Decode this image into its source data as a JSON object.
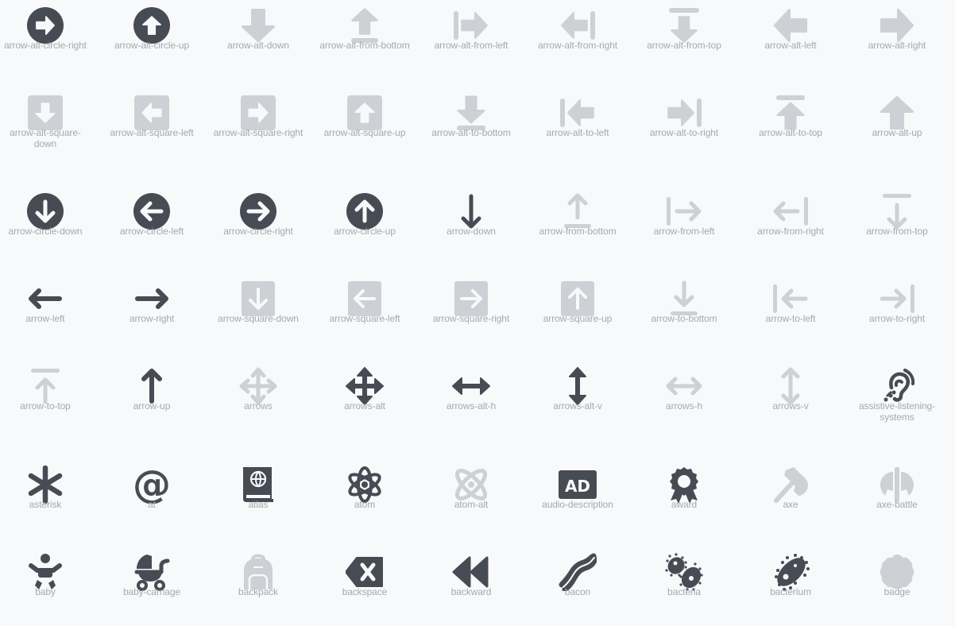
{
  "colors": {
    "background": "#f7f9fa",
    "icon_dark": "#474b53",
    "icon_light": "#cdd0d5",
    "label": "#a5a9b0"
  },
  "rows": [
    [
      {
        "name": "arrow-alt-circle-right",
        "tone": "dark"
      },
      {
        "name": "arrow-alt-circle-up",
        "tone": "dark"
      },
      {
        "name": "arrow-alt-down",
        "tone": "light"
      },
      {
        "name": "arrow-alt-from-bottom",
        "tone": "light"
      },
      {
        "name": "arrow-alt-from-left",
        "tone": "light"
      },
      {
        "name": "arrow-alt-from-right",
        "tone": "light"
      },
      {
        "name": "arrow-alt-from-top",
        "tone": "light"
      },
      {
        "name": "arrow-alt-left",
        "tone": "light"
      },
      {
        "name": "arrow-alt-right",
        "tone": "light"
      }
    ],
    [
      {
        "name": "arrow-alt-square-down",
        "tone": "light",
        "label_lines": [
          "arrow-alt-square-",
          "down"
        ]
      },
      {
        "name": "arrow-alt-square-left",
        "tone": "light"
      },
      {
        "name": "arrow-alt-square-right",
        "tone": "light"
      },
      {
        "name": "arrow-alt-square-up",
        "tone": "light"
      },
      {
        "name": "arrow-alt-to-bottom",
        "tone": "light"
      },
      {
        "name": "arrow-alt-to-left",
        "tone": "light"
      },
      {
        "name": "arrow-alt-to-right",
        "tone": "light"
      },
      {
        "name": "arrow-alt-to-top",
        "tone": "light"
      },
      {
        "name": "arrow-alt-up",
        "tone": "light"
      }
    ],
    [
      {
        "name": "arrow-circle-down",
        "tone": "dark"
      },
      {
        "name": "arrow-circle-left",
        "tone": "dark"
      },
      {
        "name": "arrow-circle-right",
        "tone": "dark"
      },
      {
        "name": "arrow-circle-up",
        "tone": "dark"
      },
      {
        "name": "arrow-down",
        "tone": "dark"
      },
      {
        "name": "arrow-from-bottom",
        "tone": "light"
      },
      {
        "name": "arrow-from-left",
        "tone": "light"
      },
      {
        "name": "arrow-from-right",
        "tone": "light"
      },
      {
        "name": "arrow-from-top",
        "tone": "light"
      }
    ],
    [
      {
        "name": "arrow-left",
        "tone": "dark"
      },
      {
        "name": "arrow-right",
        "tone": "dark"
      },
      {
        "name": "arrow-square-down",
        "tone": "light"
      },
      {
        "name": "arrow-square-left",
        "tone": "light"
      },
      {
        "name": "arrow-square-right",
        "tone": "light"
      },
      {
        "name": "arrow-square-up",
        "tone": "light"
      },
      {
        "name": "arrow-to-bottom",
        "tone": "light"
      },
      {
        "name": "arrow-to-left",
        "tone": "light"
      },
      {
        "name": "arrow-to-right",
        "tone": "light"
      }
    ],
    [
      {
        "name": "arrow-to-top",
        "tone": "light"
      },
      {
        "name": "arrow-up",
        "tone": "dark"
      },
      {
        "name": "arrows",
        "tone": "light"
      },
      {
        "name": "arrows-alt",
        "tone": "dark"
      },
      {
        "name": "arrows-alt-h",
        "tone": "dark"
      },
      {
        "name": "arrows-alt-v",
        "tone": "dark"
      },
      {
        "name": "arrows-h",
        "tone": "light"
      },
      {
        "name": "arrows-v",
        "tone": "light"
      },
      {
        "name": "assistive-listening-systems",
        "tone": "dark",
        "label_lines": [
          "assistive-listening-",
          "systems"
        ]
      }
    ],
    [
      {
        "name": "asterisk",
        "tone": "dark"
      },
      {
        "name": "at",
        "tone": "dark"
      },
      {
        "name": "atlas",
        "tone": "dark"
      },
      {
        "name": "atom",
        "tone": "dark"
      },
      {
        "name": "atom-alt",
        "tone": "light"
      },
      {
        "name": "audio-description",
        "tone": "dark",
        "glyph_text": "AD"
      },
      {
        "name": "award",
        "tone": "dark"
      },
      {
        "name": "axe",
        "tone": "light"
      },
      {
        "name": "axe-battle",
        "tone": "light"
      }
    ],
    [
      {
        "name": "baby",
        "tone": "dark"
      },
      {
        "name": "baby-carriage",
        "tone": "dark"
      },
      {
        "name": "backpack",
        "tone": "light"
      },
      {
        "name": "backspace",
        "tone": "dark"
      },
      {
        "name": "backward",
        "tone": "dark"
      },
      {
        "name": "bacon",
        "tone": "dark"
      },
      {
        "name": "bacteria",
        "tone": "dark"
      },
      {
        "name": "bacterium",
        "tone": "dark"
      },
      {
        "name": "badge",
        "tone": "light"
      }
    ]
  ]
}
